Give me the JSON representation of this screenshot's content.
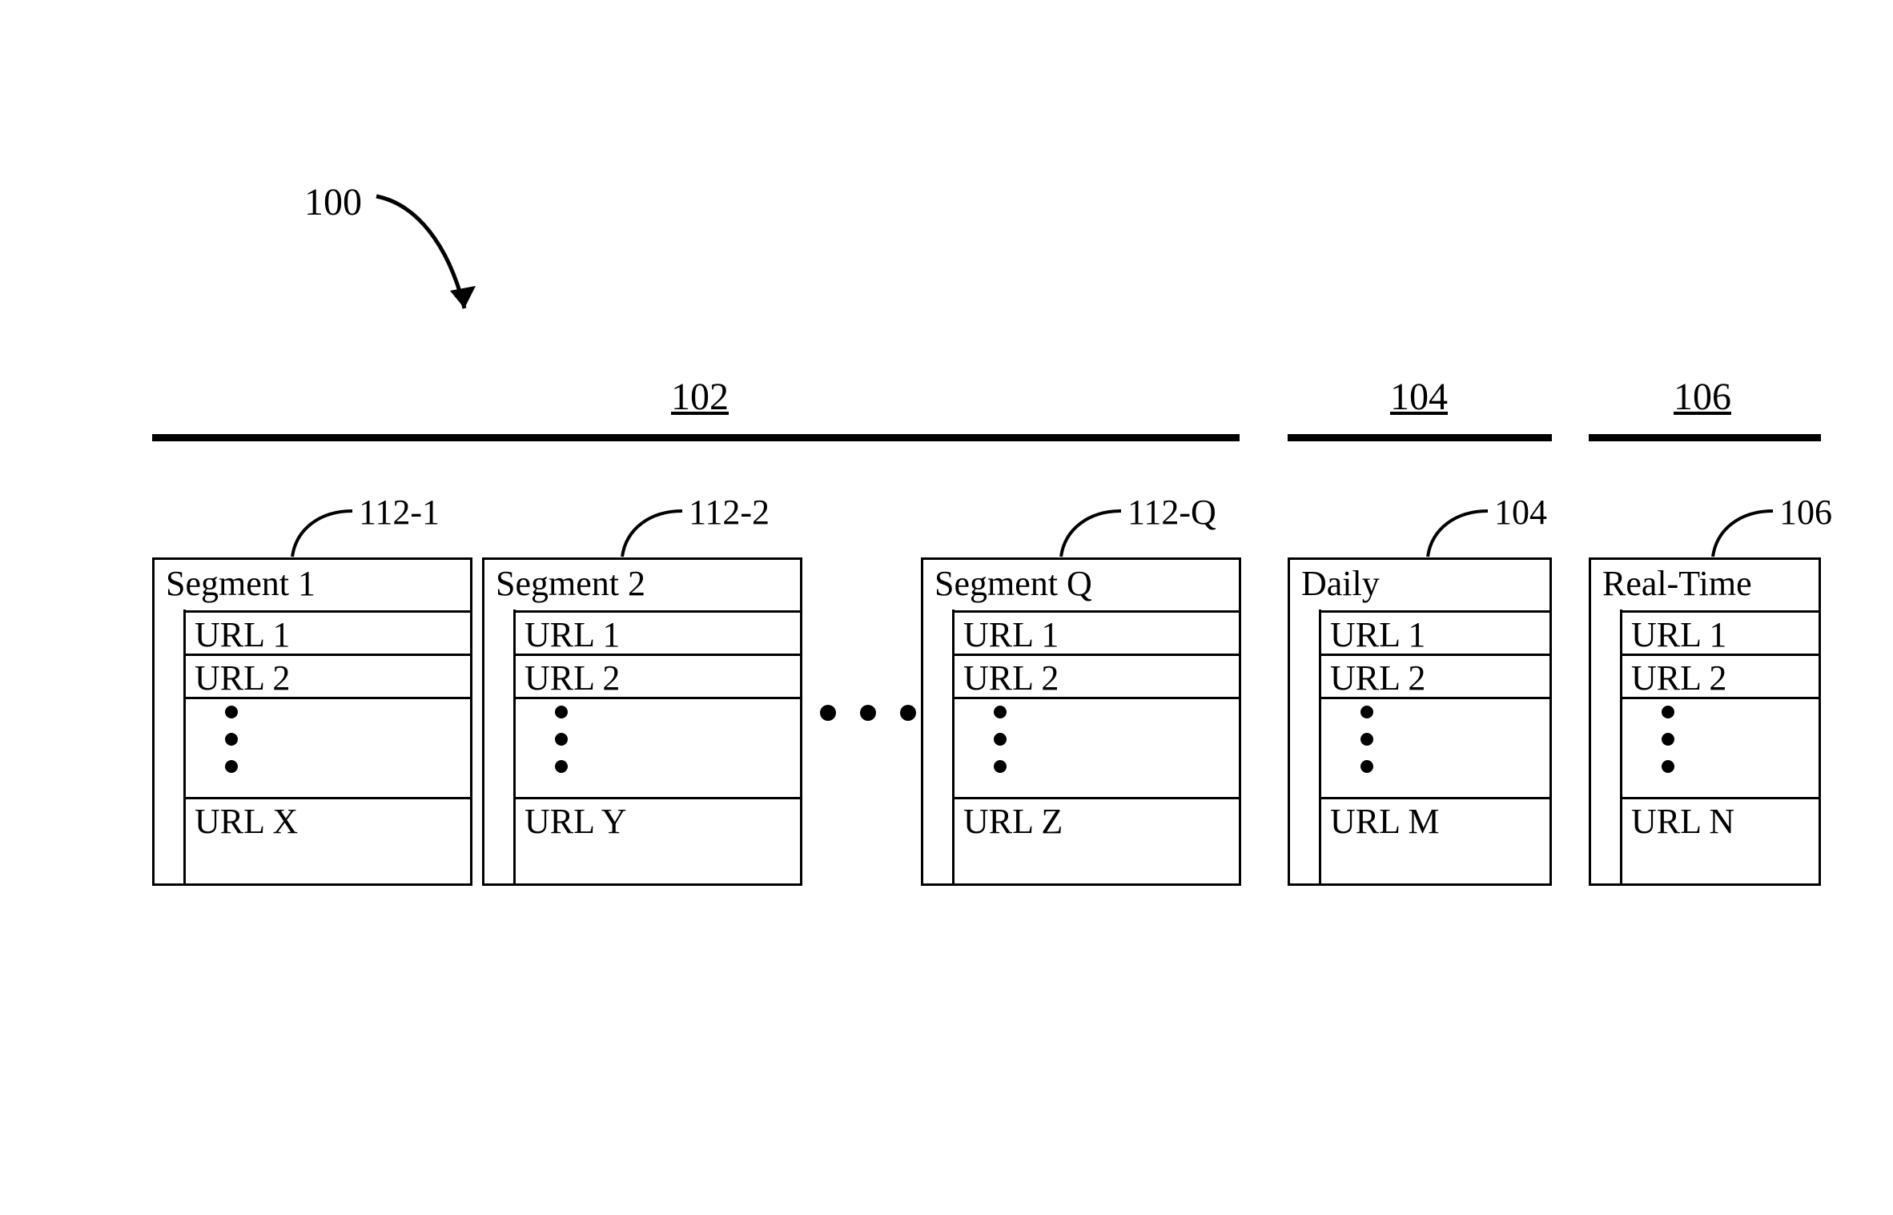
{
  "figure": {
    "overall_ref": "100",
    "sections": {
      "base": {
        "ref": "102"
      },
      "daily": {
        "ref": "104"
      },
      "realtime": {
        "ref": "106"
      }
    },
    "boxes": [
      {
        "id": "seg1",
        "callout": "112-1",
        "title": "Segment 1",
        "rows": [
          "URL 1",
          "URL 2"
        ],
        "last": "URL X"
      },
      {
        "id": "seg2",
        "callout": "112-2",
        "title": "Segment 2",
        "rows": [
          "URL 1",
          "URL 2"
        ],
        "last": "URL Y"
      },
      {
        "id": "segQ",
        "callout": "112-Q",
        "title": "Segment Q",
        "rows": [
          "URL 1",
          "URL 2"
        ],
        "last": "URL Z"
      },
      {
        "id": "daily",
        "callout": "104",
        "title": "Daily",
        "rows": [
          "URL 1",
          "URL 2"
        ],
        "last": "URL M"
      },
      {
        "id": "realtime",
        "callout": "106",
        "title": "Real-Time",
        "rows": [
          "URL 1",
          "URL 2"
        ],
        "last": "URL N"
      }
    ]
  }
}
